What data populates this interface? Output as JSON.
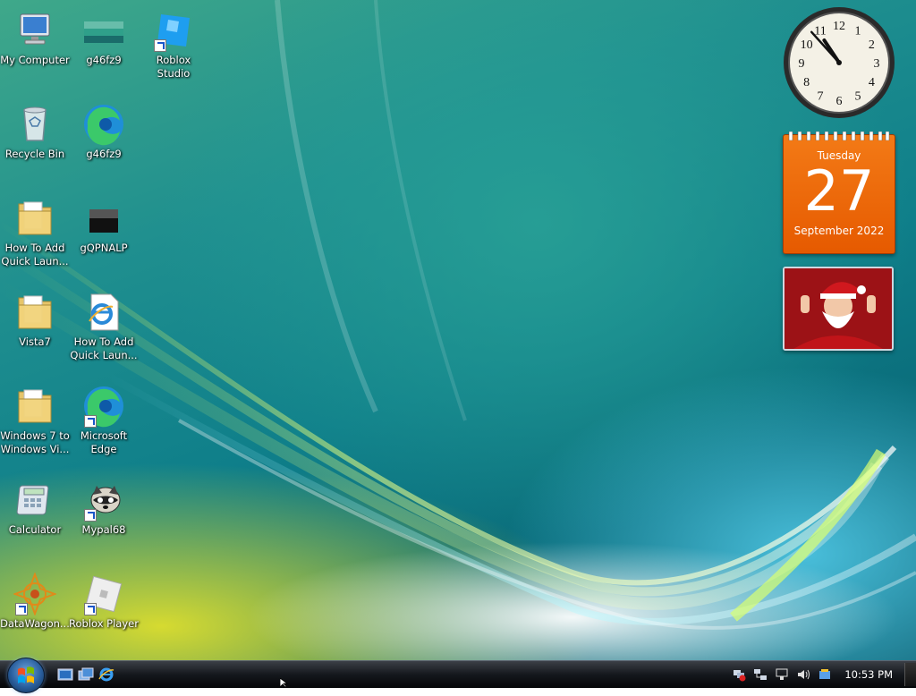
{
  "desktop": {
    "icons": [
      {
        "label": "My Computer",
        "icon": "my-computer-icon",
        "shortcut": false
      },
      {
        "label": "g46fz9",
        "icon": "image-file-icon",
        "shortcut": false
      },
      {
        "label": "Roblox Studio",
        "icon": "roblox-studio-icon",
        "shortcut": true
      },
      {
        "label": "Recycle Bin",
        "icon": "recycle-bin-icon",
        "shortcut": false
      },
      {
        "label": "g46fz9",
        "icon": "edge-icon",
        "shortcut": false
      },
      {
        "label": "How To Add Quick Laun...",
        "icon": "folder-icon",
        "shortcut": false
      },
      {
        "label": "gQPNALP",
        "icon": "black-image-icon",
        "shortcut": false
      },
      {
        "label": "Vista7",
        "icon": "folder-icon",
        "shortcut": false
      },
      {
        "label": "How To Add Quick Laun...",
        "icon": "internet-explorer-document-icon",
        "shortcut": false
      },
      {
        "label": "Windows 7 to Windows Vi...",
        "icon": "folder-icon",
        "shortcut": false
      },
      {
        "label": "Microsoft Edge",
        "icon": "edge-icon",
        "shortcut": true
      },
      {
        "label": "Calculator",
        "icon": "calculator-icon",
        "shortcut": false
      },
      {
        "label": "Mypal68",
        "icon": "raccoon-icon",
        "shortcut": true
      },
      {
        "label": "DataWagon...",
        "icon": "datawagon-icon",
        "shortcut": true
      },
      {
        "label": "Roblox Player",
        "icon": "roblox-player-icon",
        "shortcut": true
      }
    ]
  },
  "gadgets": {
    "clock": {
      "hour": 10,
      "minute": 53,
      "numerals": [
        "12",
        "1",
        "2",
        "3",
        "4",
        "5",
        "6",
        "7",
        "8",
        "9",
        "10",
        "11"
      ]
    },
    "calendar": {
      "weekday": "Tuesday",
      "day": "27",
      "month_year": "September 2022"
    },
    "slideshow": {
      "subject": "Santa Claus photo"
    }
  },
  "taskbar": {
    "start_button": "start-orb-icon",
    "quick_launch": [
      "show-desktop-icon",
      "switch-windows-icon",
      "internet-explorer-icon"
    ],
    "tray_icons": [
      "network-error-icon",
      "network-icon",
      "connection-icon",
      "volume-icon",
      "update-icon"
    ],
    "clock": "10:53 PM"
  }
}
